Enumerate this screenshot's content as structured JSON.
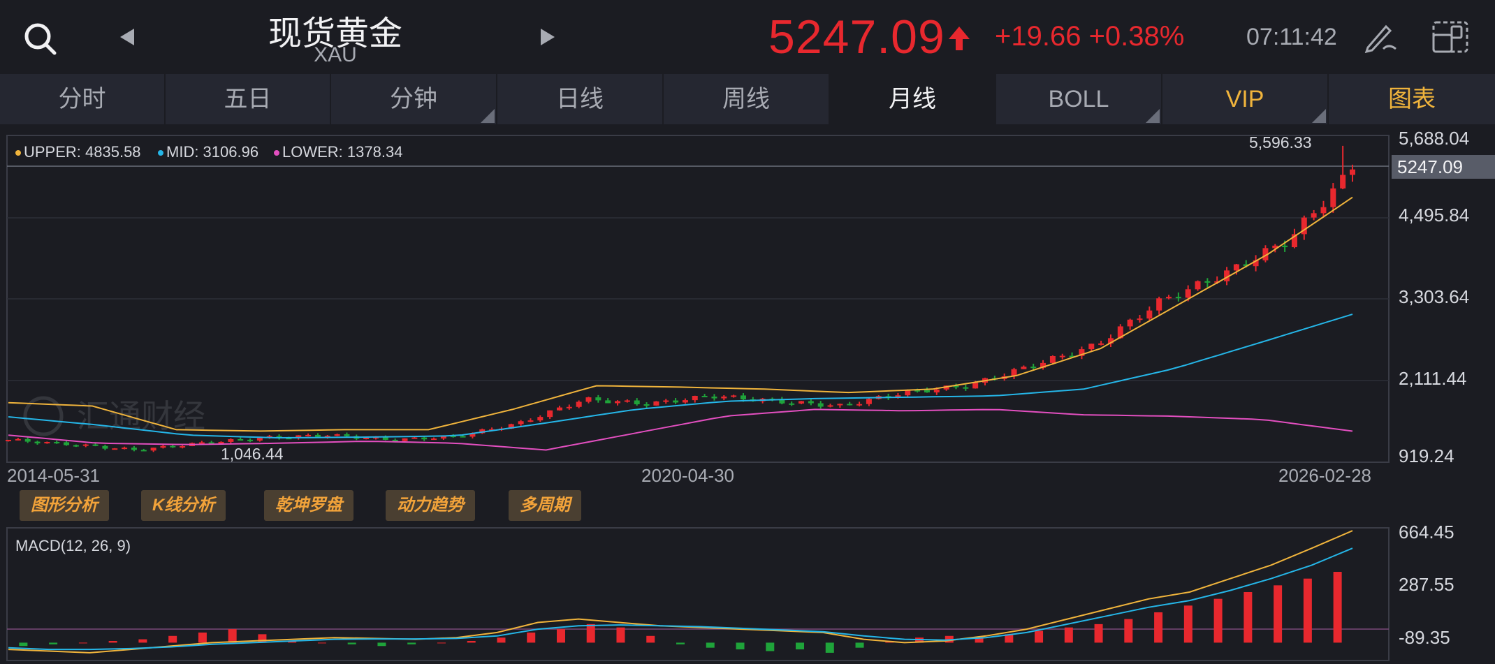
{
  "header": {
    "title": "现货黄金",
    "symbol": "XAU",
    "price": "5247.09",
    "change": "+19.66 +0.38%",
    "time": "07:11:42"
  },
  "tabs": [
    {
      "label": "分时"
    },
    {
      "label": "五日"
    },
    {
      "label": "分钟"
    },
    {
      "label": "日线"
    },
    {
      "label": "周线"
    },
    {
      "label": "月线"
    },
    {
      "label": "BOLL"
    },
    {
      "label": "VIP"
    },
    {
      "label": "图表"
    }
  ],
  "indicators": {
    "upper": "UPPER: 4835.58",
    "mid": "MID: 3106.96",
    "lower": "LOWER: 1378.34",
    "macd": "MACD(12, 26, 9)"
  },
  "price_axis": [
    "5,688.04",
    "4,495.84",
    "3,303.64",
    "2,111.44",
    "919.24"
  ],
  "current_price_tag": "5247.09",
  "high_label": "5,596.33",
  "low_label": "1,046.44",
  "date_axis": [
    "2014-05-31",
    "2020-04-30",
    "2026-02-28"
  ],
  "macd_axis": [
    "664.45",
    "287.55",
    "-89.35"
  ],
  "tool_buttons": [
    "图形分析",
    "K线分析",
    "乾坤罗盘",
    "动力趋势",
    "多周期"
  ],
  "watermark": "汇通财经",
  "colors": {
    "up": "#e8282e",
    "down": "#1fa33a",
    "upper": "#f0b43c",
    "mid": "#25b6e8",
    "lower": "#e34fc0",
    "accent": "#f0b43c"
  },
  "chart_data": [
    {
      "type": "line",
      "name": "candles-monthly-xau",
      "ylim": [
        919.24,
        5688.04
      ],
      "x": [
        "2014-05-31",
        "2020-04-30",
        "2026-02-28"
      ],
      "close_samples": [
        1250,
        1180,
        1100,
        1200,
        1280,
        1320,
        1250,
        1300,
        1500,
        1850,
        1780,
        1900,
        1820,
        1750,
        1950,
        2050,
        2350,
        2650,
        3300,
        3700,
        4200,
        5247.09
      ],
      "high": 5596.33,
      "low": 1046.44
    },
    {
      "type": "line",
      "name": "boll",
      "series": [
        {
          "name": "UPPER",
          "values": [
            1800,
            1750,
            1400,
            1380,
            1400,
            1400,
            1700,
            2050,
            2030,
            2000,
            1950,
            2000,
            2200,
            2600,
            3300,
            4000,
            4835.58
          ]
        },
        {
          "name": "MID",
          "values": [
            1590,
            1470,
            1320,
            1280,
            1290,
            1310,
            1500,
            1700,
            1820,
            1860,
            1880,
            1900,
            2000,
            2300,
            2700,
            3106.96
          ]
        },
        {
          "name": "LOWER",
          "values": [
            1320,
            1200,
            1180,
            1200,
            1230,
            1200,
            1100,
            1350,
            1600,
            1700,
            1680,
            1700,
            1620,
            1600,
            1550,
            1378.34
          ]
        }
      ]
    },
    {
      "type": "bar",
      "name": "macd",
      "ylim": [
        -89.35,
        664.45
      ]
    }
  ]
}
